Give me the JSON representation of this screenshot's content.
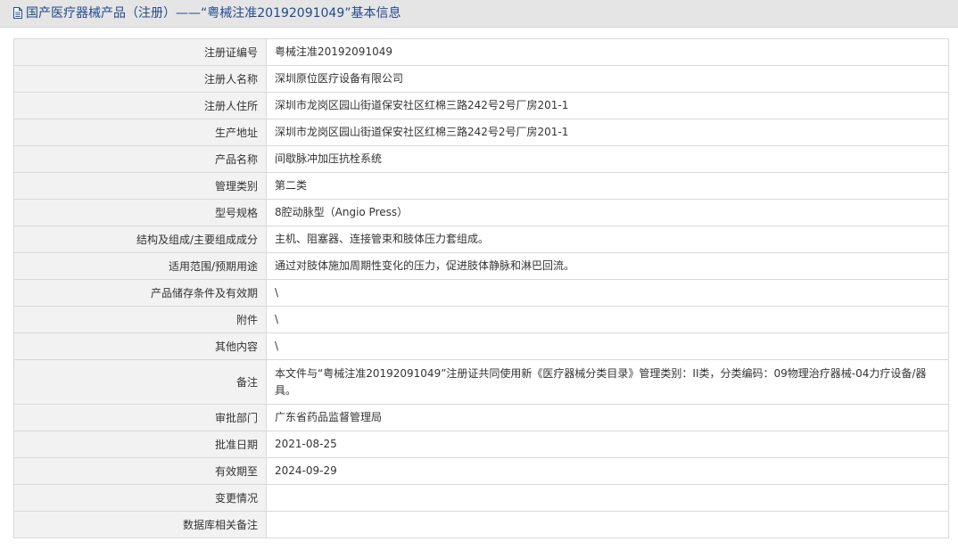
{
  "header": {
    "title": "国产医疗器械产品（注册）——“粤械注准20192091049”基本信息"
  },
  "rows": [
    {
      "label": "注册证编号",
      "value": "粤械注准20192091049"
    },
    {
      "label": "注册人名称",
      "value": "深圳原位医疗设备有限公司"
    },
    {
      "label": "注册人住所",
      "value": "深圳市龙岗区园山街道保安社区红棉三路242号2号厂房201-1"
    },
    {
      "label": "生产地址",
      "value": "深圳市龙岗区园山街道保安社区红棉三路242号2号厂房201-1"
    },
    {
      "label": "产品名称",
      "value": "间歇脉冲加压抗栓系统"
    },
    {
      "label": "管理类别",
      "value": "第二类"
    },
    {
      "label": "型号规格",
      "value": "8腔动脉型（Angio Press）"
    },
    {
      "label": "结构及组成/主要组成成分",
      "value": "主机、阻塞器、连接管束和肢体压力套组成。"
    },
    {
      "label": "适用范围/预期用途",
      "value": "通过对肢体施加周期性变化的压力，促进肢体静脉和淋巴回流。"
    },
    {
      "label": "产品储存条件及有效期",
      "value": "\\"
    },
    {
      "label": "附件",
      "value": "\\"
    },
    {
      "label": "其他内容",
      "value": "\\"
    },
    {
      "label": "备注",
      "value": "本文件与“粤械注准20192091049”注册证共同使用新《医疗器械分类目录》管理类别：II类，分类编码：09物理治疗器械-04力疗设备/器具。"
    },
    {
      "label": "审批部门",
      "value": "广东省药品监督管理局"
    },
    {
      "label": "批准日期",
      "value": "2021-08-25"
    },
    {
      "label": "有效期至",
      "value": "2024-09-29"
    },
    {
      "label": "变更情况",
      "value": ""
    },
    {
      "label": "数据库相关备注",
      "value": ""
    }
  ]
}
